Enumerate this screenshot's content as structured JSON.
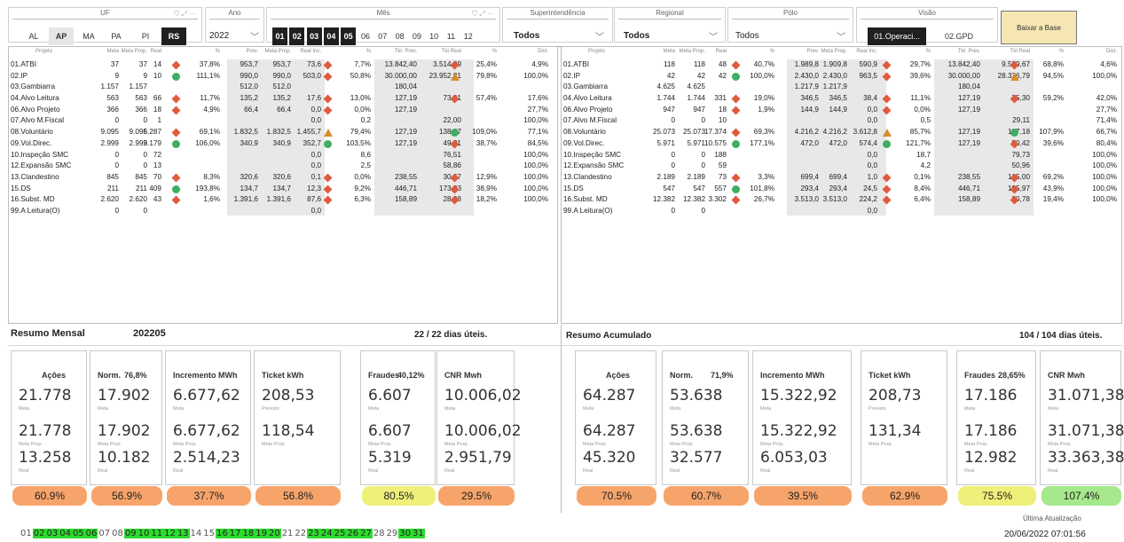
{
  "slicers": {
    "uf": {
      "title": "UF",
      "options": [
        "AL",
        "AP",
        "MA",
        "PA",
        "PI",
        "RS"
      ],
      "selected": [
        "AP",
        "RS"
      ]
    },
    "ano": {
      "title": "Ano",
      "value": "2022"
    },
    "mes": {
      "title": "Mês",
      "options": [
        "01",
        "02",
        "03",
        "04",
        "05",
        "06",
        "07",
        "08",
        "09",
        "10",
        "11",
        "12"
      ],
      "selected": [
        "01",
        "02",
        "03",
        "04",
        "05"
      ]
    },
    "superintendencia": {
      "title": "Superintendência",
      "value": "Todos"
    },
    "regional": {
      "title": "Regional",
      "value": "Todos"
    },
    "polo": {
      "title": "Pólo",
      "value": "Todos"
    },
    "visao": {
      "title": "Visão",
      "options": [
        "01.Operaci...",
        "02.GPD"
      ],
      "selected": "01.Operaci..."
    },
    "baixar": "Baixar a Base"
  },
  "table_headers": [
    "Projeto",
    "Meta",
    "Meta Prop.",
    "Real",
    "%",
    "Prev.",
    "Meta Prop.",
    "Real Inc.",
    "%",
    "Tkt. Prev.",
    "Tkt Real",
    "%",
    "Dist."
  ],
  "left_rows": [
    [
      "01.ATBI",
      "37",
      "37",
      "14",
      "d",
      "37,8%",
      "953,7",
      "953,7",
      "73,6",
      "d",
      "7,7%",
      "13.842,40",
      "3.514,29",
      "d",
      "25,4%",
      "4,9%"
    ],
    [
      "02.IP",
      "9",
      "9",
      "10",
      "c",
      "111,1%",
      "990,0",
      "990,0",
      "503,0",
      "d",
      "50,8%",
      "30.000,00",
      "23.952,81",
      "t",
      "79,8%",
      "100,0%"
    ],
    [
      "03.Gambiarra",
      "1.157",
      "1.157",
      "",
      "",
      "",
      "512,0",
      "512,0",
      "",
      "",
      "",
      "180,04",
      "",
      "",
      "",
      ""
    ],
    [
      "04.Alvo Leitura",
      "563",
      "563",
      "66",
      "d",
      "11,7%",
      "135,2",
      "135,2",
      "17,6",
      "d",
      "13,0%",
      "127,19",
      "73,01",
      "d",
      "57,4%",
      "17,6%"
    ],
    [
      "06.Alvo Projeto",
      "366",
      "366",
      "18",
      "d",
      "4,9%",
      "66,4",
      "66,4",
      "0,0",
      "d",
      "0,0%",
      "127,19",
      "",
      "",
      "",
      "27,7%"
    ],
    [
      "07.Alvo M.Fiscal",
      "0",
      "0",
      "1",
      "",
      "",
      "",
      "",
      "0,0",
      "",
      "0,2",
      "",
      "22,00",
      "",
      "",
      "100,0%"
    ],
    [
      "08.Voluntário",
      "9.095",
      "9.095",
      "6.287",
      "d",
      "69,1%",
      "1.832,5",
      "1.832,5",
      "1.455,7",
      "t",
      "79,4%",
      "127,19",
      "138,67",
      "c",
      "109,0%",
      "77,1%"
    ],
    [
      "09.Vol.Direc.",
      "2.999",
      "2.999",
      "3.179",
      "c",
      "106,0%",
      "340,9",
      "340,9",
      "352,7",
      "c",
      "103,5%",
      "127,19",
      "49,21",
      "d",
      "38,7%",
      "84,5%"
    ],
    [
      "10.Inspeção SMC",
      "0",
      "0",
      "72",
      "",
      "",
      "",
      "",
      "0,0",
      "",
      "8,6",
      "",
      "76,51",
      "",
      "",
      "100,0%"
    ],
    [
      "12.Expansão SMC",
      "0",
      "0",
      "13",
      "",
      "",
      "",
      "",
      "0,0",
      "",
      "2,5",
      "",
      "58,86",
      "",
      "",
      "100,0%"
    ],
    [
      "13.Clandestino",
      "845",
      "845",
      "70",
      "d",
      "8,3%",
      "320,6",
      "320,6",
      "0,1",
      "d",
      "0,0%",
      "238,55",
      "30,67",
      "d",
      "12,9%",
      "100,0%"
    ],
    [
      "15.DS",
      "211",
      "211",
      "409",
      "c",
      "193,8%",
      "134,7",
      "134,7",
      "12,3",
      "d",
      "9,2%",
      "446,71",
      "173,83",
      "d",
      "38,9%",
      "100,0%"
    ],
    [
      "16.Subst. MD",
      "2.620",
      "2.620",
      "43",
      "d",
      "1,6%",
      "1.391,6",
      "1.391,6",
      "87,6",
      "d",
      "6,3%",
      "158,89",
      "28,98",
      "d",
      "18,2%",
      "100,0%"
    ],
    [
      "99.A Leitura(O)",
      "0",
      "0",
      "",
      "",
      "",
      "",
      "",
      "0,0",
      "",
      "",
      "",
      "",
      "",
      "",
      ""
    ]
  ],
  "right_rows": [
    [
      "01.ATBI",
      "118",
      "118",
      "48",
      "d",
      "40,7%",
      "1.989,8",
      "1.909,8",
      "590,9",
      "d",
      "29,7%",
      "13.842,40",
      "9.529,67",
      "d",
      "68,8%",
      "4,6%"
    ],
    [
      "02.IP",
      "42",
      "42",
      "42",
      "c",
      "100,0%",
      "2.430,0",
      "2.430,0",
      "963,5",
      "d",
      "39,6%",
      "30.000,00",
      "28.336,79",
      "t",
      "94,5%",
      "100,0%"
    ],
    [
      "03.Gambiarra",
      "4.625",
      "4.625",
      "",
      "",
      "",
      "1.217,9",
      "1.217,9",
      "",
      "",
      "",
      "180,04",
      "",
      "",
      "",
      ""
    ],
    [
      "04.Alvo Leitura",
      "1.744",
      "1.744",
      "331",
      "d",
      "19,0%",
      "346,5",
      "346,5",
      "38,4",
      "d",
      "11,1%",
      "127,19",
      "75,30",
      "d",
      "59,2%",
      "42,0%"
    ],
    [
      "06.Alvo Projeto",
      "947",
      "947",
      "18",
      "d",
      "1,9%",
      "144,9",
      "144,9",
      "0,0",
      "d",
      "0,0%",
      "127,19",
      "",
      "",
      "",
      "27,7%"
    ],
    [
      "07.Alvo M.Fiscal",
      "0",
      "0",
      "10",
      "",
      "",
      "",
      "",
      "0,0",
      "",
      "0,5",
      "",
      "29,11",
      "",
      "",
      "71,4%"
    ],
    [
      "08.Voluntário",
      "25.073",
      "25.073",
      "17.374",
      "d",
      "69,3%",
      "4.216,2",
      "4.216,2",
      "3.612,8",
      "t",
      "85,7%",
      "127,19",
      "137,18",
      "c",
      "107,9%",
      "66,7%"
    ],
    [
      "09.Vol.Direc.",
      "5.971",
      "5.971",
      "10.575",
      "c",
      "177,1%",
      "472,0",
      "472,0",
      "574,4",
      "c",
      "121,7%",
      "127,19",
      "50,42",
      "d",
      "39,6%",
      "80,4%"
    ],
    [
      "10.Inspeção SMC",
      "0",
      "0",
      "188",
      "",
      "",
      "",
      "",
      "0,0",
      "",
      "18,7",
      "",
      "79,73",
      "",
      "",
      "100,0%"
    ],
    [
      "12.Expansão SMC",
      "0",
      "0",
      "59",
      "",
      "",
      "",
      "",
      "0,0",
      "",
      "4,2",
      "",
      "50,96",
      "",
      "",
      "100,0%"
    ],
    [
      "13.Clandestino",
      "2.189",
      "2.189",
      "73",
      "d",
      "3,3%",
      "699,4",
      "699,4",
      "1,0",
      "d",
      "0,1%",
      "238,55",
      "165,00",
      "d",
      "69,2%",
      "100,0%"
    ],
    [
      "15.DS",
      "547",
      "547",
      "557",
      "c",
      "101,8%",
      "293,4",
      "293,4",
      "24,5",
      "d",
      "8,4%",
      "446,71",
      "195,97",
      "d",
      "43,9%",
      "100,0%"
    ],
    [
      "16.Subst. MD",
      "12.382",
      "12.382",
      "3.302",
      "d",
      "26,7%",
      "3.513,0",
      "3.513,0",
      "224,2",
      "d",
      "6,4%",
      "158,89",
      "30,78",
      "d",
      "19,4%",
      "100,0%"
    ],
    [
      "99.A Leitura(O)",
      "0",
      "0",
      "",
      "",
      "",
      "",
      "",
      "0,0",
      "",
      "",
      "",
      "",
      "",
      "",
      ""
    ]
  ],
  "mensal": {
    "title": "Resumo Mensal",
    "period": "202205",
    "dias": "22 / 22 dias úteis.",
    "cards": [
      {
        "title": "Ações",
        "pct": "",
        "meta": "21.778",
        "prop": "21.778",
        "real": "13.258",
        "pill": "60.9%"
      },
      {
        "title": "Norm.",
        "pct": "76,8%",
        "meta": "17.902",
        "prop": "17.902",
        "real": "10.182",
        "pill": "56.9%"
      },
      {
        "title": "Incremento MWh",
        "pct": "",
        "meta": "6.677,62",
        "prop": "6.677,62",
        "real": "2.514,23",
        "pill": "37.7%"
      },
      {
        "title": "Ticket kWh",
        "pct": "",
        "meta": "208,53",
        "prop": "118,54",
        "real": "",
        "pill": "56.8%"
      },
      {
        "title": "Fraudes",
        "pct": "40,12%",
        "meta": "6.607",
        "prop": "6.607",
        "real": "5.319",
        "pill": "80.5%"
      },
      {
        "title": "CNR Mwh",
        "pct": "",
        "meta": "10.006,02",
        "prop": "10.006,02",
        "real": "2.951,79",
        "pill": "29.5%"
      }
    ]
  },
  "acumulado": {
    "title": "Resumo Acumulado",
    "dias": "104 / 104 dias úteis.",
    "cards": [
      {
        "title": "Ações",
        "pct": "",
        "meta": "64.287",
        "prop": "64.287",
        "real": "45.320",
        "pill": "70.5%"
      },
      {
        "title": "Norm.",
        "pct": "71,9%",
        "meta": "53.638",
        "prop": "53.638",
        "real": "32.577",
        "pill": "60.7%"
      },
      {
        "title": "Incremento MWh",
        "pct": "",
        "meta": "15.322,92",
        "prop": "15.322,92",
        "real": "6.053,03",
        "pill": "39.5%"
      },
      {
        "title": "Ticket kWh",
        "pct": "",
        "meta": "208,73",
        "prop": "131,34",
        "real": "",
        "pill": "62.9%"
      },
      {
        "title": "Fraudes",
        "pct": "28,65%",
        "meta": "17.186",
        "prop": "17.186",
        "real": "12.982",
        "pill": "75.5%"
      },
      {
        "title": "CNR Mwh",
        "pct": "",
        "meta": "31.071,38",
        "prop": "31.071,38",
        "real": "33.363,38",
        "pill": "107.4%"
      }
    ]
  },
  "labels": {
    "meta": "Meta",
    "prop": "Meta Prop.",
    "real": "Real",
    "previsto": "Previsto"
  },
  "pill_colors": {
    "orange": "#f7a46b",
    "yellow": "#eef07a",
    "green": "#a6e88c"
  },
  "days": {
    "values": [
      "01",
      "02",
      "03",
      "04",
      "05",
      "06",
      "07",
      "08",
      "09",
      "10",
      "11",
      "12",
      "13",
      "14",
      "15",
      "16",
      "17",
      "18",
      "19",
      "20",
      "21",
      "22",
      "23",
      "24",
      "25",
      "26",
      "27",
      "28",
      "29",
      "30",
      "31"
    ],
    "highlighted": [
      "02",
      "03",
      "04",
      "05",
      "06",
      "09",
      "10",
      "11",
      "12",
      "13",
      "16",
      "17",
      "18",
      "19",
      "20",
      "23",
      "24",
      "25",
      "26",
      "27",
      "30",
      "31"
    ]
  },
  "update": {
    "label": "Última Atualização",
    "value": "20/06/2022 07:01:56"
  }
}
